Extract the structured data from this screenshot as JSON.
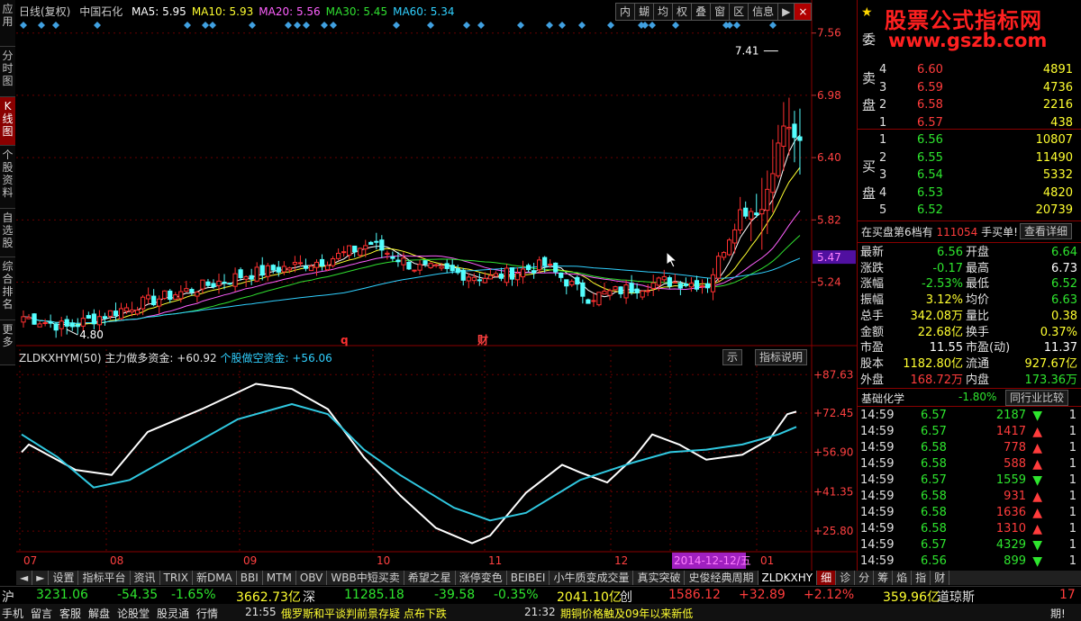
{
  "left_tabs": [
    "应用",
    "分时图",
    "K线图",
    "个股资料",
    "自选股",
    "综合排名",
    "更多"
  ],
  "header": {
    "title": "日线(复权)",
    "stock": "中国石化",
    "ma": [
      {
        "label": "MA5: 5.95",
        "color": "#ffffff"
      },
      {
        "label": "MA10: 5.93",
        "color": "#ffff30"
      },
      {
        "label": "MA20: 5.56",
        "color": "#ff60ff"
      },
      {
        "label": "MA30: 5.45",
        "color": "#30e030"
      },
      {
        "label": "MA60: 5.34",
        "color": "#30d0ff"
      }
    ]
  },
  "toolbar": [
    "内",
    "蝴",
    "均",
    "权",
    "叠",
    "窗",
    "区",
    "信息",
    "▶"
  ],
  "price_axis": [
    "7.56",
    "6.98",
    "6.40",
    "5.82",
    "5.24"
  ],
  "current_price_tag": "5.47",
  "max_label": "7.41",
  "min_label": "4.80",
  "event_labels": [
    {
      "text": "q"
    },
    {
      "text": "财"
    }
  ],
  "indicator": {
    "name": "ZLDKXHYM(50)",
    "line1": "主力做多资金: +60.92",
    "line2": "个股做空资金: +56.06",
    "btn1": "示",
    "btn2": "指标说明",
    "axis": [
      "+87.63",
      "+72.45",
      "+56.90",
      "+41.35",
      "+25.80"
    ]
  },
  "date_axis": [
    {
      "label": "07"
    },
    {
      "label": "08"
    },
    {
      "label": "09"
    },
    {
      "label": "10"
    },
    {
      "label": "11"
    },
    {
      "label": "12"
    },
    {
      "label": "2014-12-12/五",
      "highlight": true
    },
    {
      "label": "01"
    }
  ],
  "watermark": {
    "line1": "股票公式指标网",
    "line2": "www.gszb.com"
  },
  "order_book": {
    "sell_label_top": "委",
    "sell_label": "卖盘",
    "buy_label": "买盘",
    "sell": [
      {
        "lv": "4",
        "price": "6.60",
        "vol": "4891"
      },
      {
        "lv": "3",
        "price": "6.59",
        "vol": "4736"
      },
      {
        "lv": "2",
        "price": "6.58",
        "vol": "2216"
      },
      {
        "lv": "1",
        "price": "6.57",
        "vol": "438"
      }
    ],
    "buy": [
      {
        "lv": "1",
        "price": "6.56",
        "vol": "10807"
      },
      {
        "lv": "2",
        "price": "6.55",
        "vol": "11490"
      },
      {
        "lv": "3",
        "price": "6.54",
        "vol": "5332"
      },
      {
        "lv": "4",
        "price": "6.53",
        "vol": "4820"
      },
      {
        "lv": "5",
        "price": "6.52",
        "vol": "20739"
      }
    ]
  },
  "notice": {
    "text1": "在买盘第6档有",
    "num": "111054",
    "text2": "手买单!",
    "detail": "查看详细"
  },
  "stats": [
    {
      "l1": "最新",
      "v1": "6.56",
      "c1": "green",
      "l2": "开盘",
      "v2": "6.64",
      "c2": "green"
    },
    {
      "l1": "涨跌",
      "v1": "-0.17",
      "c1": "green",
      "l2": "最高",
      "v2": "6.73",
      "c2": "white"
    },
    {
      "l1": "涨幅",
      "v1": "-2.53%",
      "c1": "green",
      "l2": "最低",
      "v2": "6.52",
      "c2": "green"
    },
    {
      "l1": "振幅",
      "v1": "3.12%",
      "c1": "yellow",
      "l2": "均价",
      "v2": "6.63",
      "c2": "green"
    },
    {
      "l1": "总手",
      "v1": "342.08万",
      "c1": "yellow",
      "l2": "量比",
      "v2": "0.38",
      "c2": "yellow"
    },
    {
      "l1": "金额",
      "v1": "22.68亿",
      "c1": "yellow",
      "l2": "换手",
      "v2": "0.37%",
      "c2": "yellow"
    },
    {
      "l1": "市盈",
      "v1": "11.55",
      "c1": "white",
      "l2": "市盈(动)",
      "v2": "11.37",
      "c2": "white"
    },
    {
      "l1": "股本",
      "v1": "1182.80亿",
      "c1": "yellow",
      "l2": "流通",
      "v2": "927.67亿",
      "c2": "yellow"
    },
    {
      "l1": "外盘",
      "v1": "168.72万",
      "c1": "red",
      "l2": "内盘",
      "v2": "173.36万",
      "c2": "green"
    }
  ],
  "sector": {
    "name": "基础化学",
    "change": "-1.80%",
    "btn": "同行业比较"
  },
  "ticks": [
    {
      "time": "14:59",
      "price": "6.57",
      "vol": "2187",
      "dir": "down",
      "n": "1"
    },
    {
      "time": "14:59",
      "price": "6.57",
      "vol": "1417",
      "dir": "up",
      "n": "1"
    },
    {
      "time": "14:59",
      "price": "6.58",
      "vol": "778",
      "dir": "up",
      "n": "1"
    },
    {
      "time": "14:59",
      "price": "6.58",
      "vol": "588",
      "dir": "up",
      "n": "1"
    },
    {
      "time": "14:59",
      "price": "6.57",
      "vol": "1559",
      "dir": "down",
      "n": "1"
    },
    {
      "time": "14:59",
      "price": "6.58",
      "vol": "931",
      "dir": "up",
      "n": "1"
    },
    {
      "time": "14:59",
      "price": "6.58",
      "vol": "1636",
      "dir": "up",
      "n": "1"
    },
    {
      "time": "14:59",
      "price": "6.58",
      "vol": "1310",
      "dir": "up",
      "n": "1"
    },
    {
      "time": "14:59",
      "price": "6.57",
      "vol": "4329",
      "dir": "down",
      "n": "1"
    },
    {
      "time": "14:59",
      "price": "6.56",
      "vol": "899",
      "dir": "down",
      "n": "1"
    }
  ],
  "bottom_tabs": [
    "设置",
    "指标平台",
    "资讯",
    "TRIX",
    "新DMA",
    "BBI",
    "MTM",
    "OBV",
    "WBB中短买卖",
    "希望之星",
    "涨停变色",
    "BEIBEI",
    "小牛质变成交量",
    "真实突破",
    "史俊经典周期",
    "ZLDKXHY",
    "细",
    "诊",
    "分",
    "筹",
    "焰",
    "指",
    "财"
  ],
  "status": {
    "sh_label": "沪",
    "sh_idx": "3231.06",
    "sh_chg": "-54.35",
    "sh_pct": "-1.65%",
    "sh_amt": "3662.73亿",
    "sz_label": "深",
    "sz_idx": "11285.18",
    "sz_chg": "-39.58",
    "sz_pct": "-0.35%",
    "sz_amt": "2041.10亿",
    "cy_label": "创",
    "cy_idx": "1586.12",
    "cy_chg": "+32.89",
    "cy_pct": "+2.12%",
    "cy_amt": "359.96亿",
    "dj_label": "道琼斯",
    "dj_val": "17"
  },
  "ticker": {
    "items": [
      "手机",
      "留言",
      "客服",
      "解盘",
      "论股堂",
      "股灵通",
      "行情"
    ],
    "news1_time": "21:55",
    "news1": "俄罗斯和平谈判前景存疑 点布下跌",
    "news2_time": "21:32",
    "news2": "期铜价格触及09年以来新低",
    "end": "期!"
  },
  "chart_data": {
    "type": "candlestick",
    "price_ylim": [
      4.7,
      7.7
    ],
    "indicator_ylim": [
      18.0,
      92.0
    ]
  }
}
